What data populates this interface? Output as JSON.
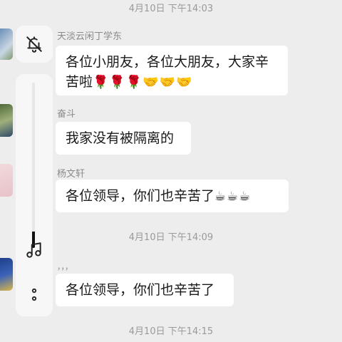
{
  "timestamps": [
    "4月10日 下午14:03",
    "4月10日 下午14:09",
    "4月10日 下午14:15"
  ],
  "messages": [
    {
      "sender": "天淡云闲丁学东",
      "text_line1": "各位小朋友，各位大朋友，大家辛",
      "text_line2": "苦啦",
      "emoji": "🌹🌹🌹🤝🤝🤝"
    },
    {
      "sender": "奋斗",
      "text": "我家没有被隔离的"
    },
    {
      "sender": "杨文轩",
      "text": "各位领导，你们也辛苦了",
      "emoji": "☕☕☕"
    },
    {
      "sender": "，，，",
      "text": "各位领导，你们也辛苦了"
    }
  ],
  "volume_panel": {
    "mute_icon": "bell-slash-icon",
    "level": 0.1,
    "music_icon": "music-note-icon",
    "more_icon": "more-vertical-icon"
  },
  "colors": {
    "background": "#ededed",
    "bubble": "#ffffff",
    "timestamp": "#9a9a9a",
    "sender": "#8a8a8a"
  }
}
